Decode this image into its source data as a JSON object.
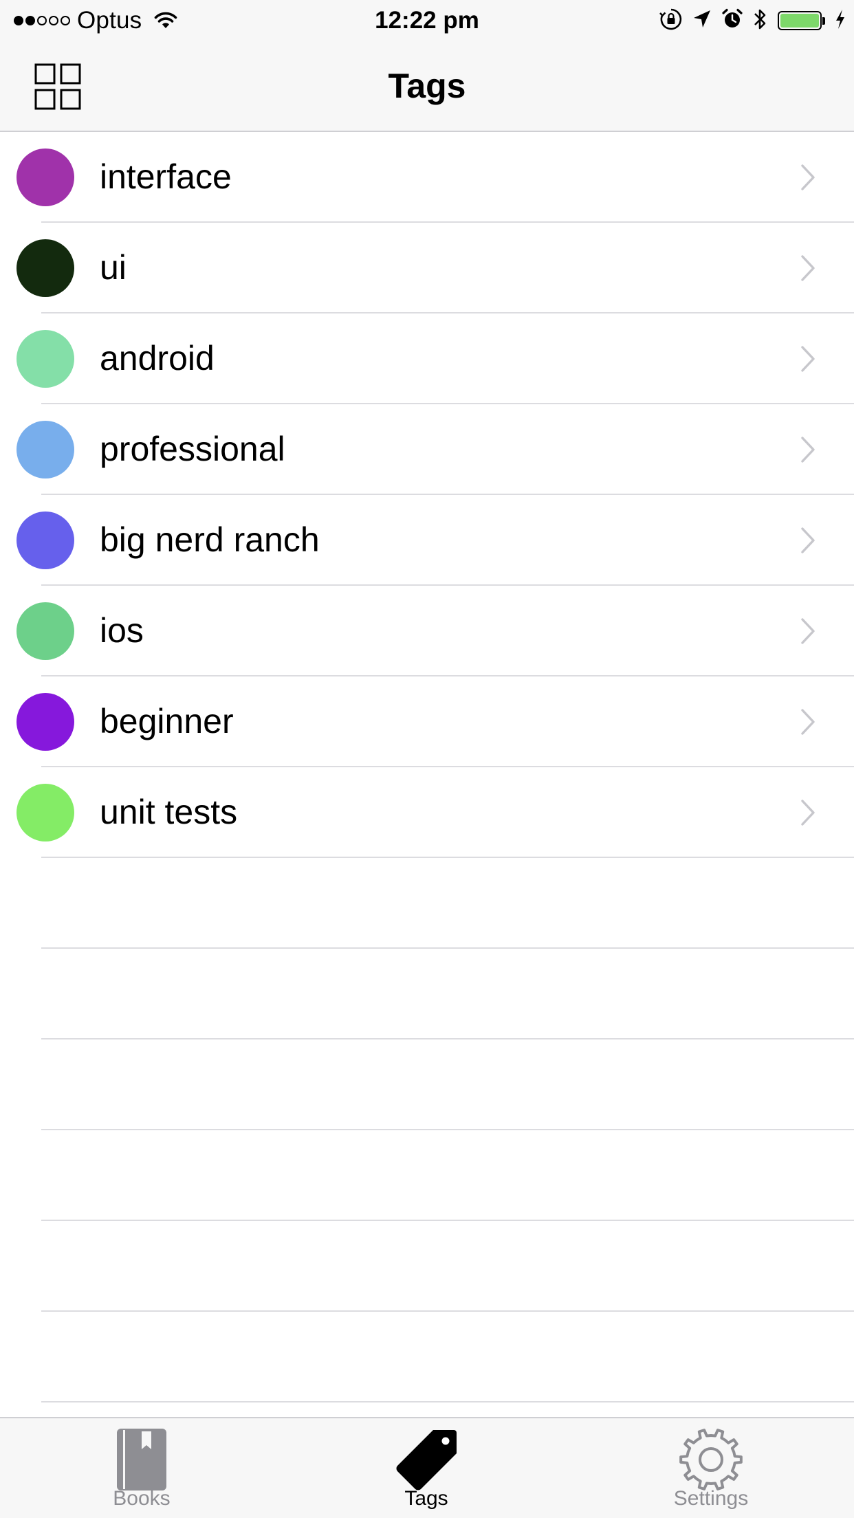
{
  "status_bar": {
    "carrier": "Optus",
    "time": "12:22 pm",
    "signal_filled": 2,
    "signal_total": 5,
    "battery_color": "#7dd86a"
  },
  "nav": {
    "title": "Tags",
    "left_icon": "grid-icon"
  },
  "tags": [
    {
      "label": "interface",
      "color": "#a032aa"
    },
    {
      "label": "ui",
      "color": "#132a0e"
    },
    {
      "label": "android",
      "color": "#84dfa8"
    },
    {
      "label": "professional",
      "color": "#78aeec"
    },
    {
      "label": "big nerd ranch",
      "color": "#6660ec"
    },
    {
      "label": "ios",
      "color": "#6dd08a"
    },
    {
      "label": "beginner",
      "color": "#8618dc"
    },
    {
      "label": "unit tests",
      "color": "#84ec66"
    }
  ],
  "tab_bar": {
    "tabs": [
      {
        "label": "Books",
        "icon": "book-icon",
        "selected": false
      },
      {
        "label": "Tags",
        "icon": "tag-icon",
        "selected": true
      },
      {
        "label": "Settings",
        "icon": "gear-icon",
        "selected": false
      }
    ],
    "active_color": "#000000",
    "inactive_color": "#8e8e93"
  }
}
